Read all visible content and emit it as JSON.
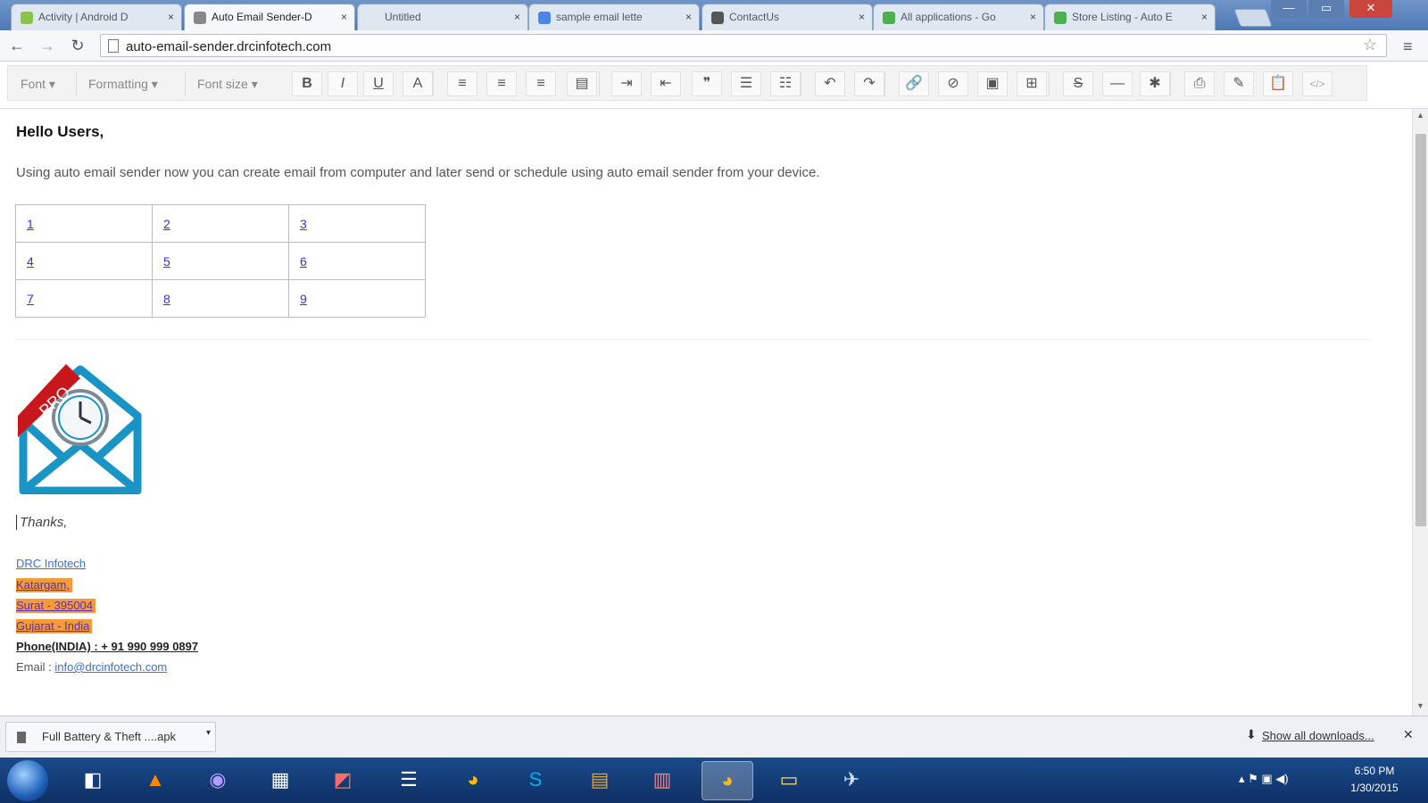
{
  "browser": {
    "tabs": [
      {
        "title": "Activity | Android D",
        "favicon_color": "#8bc34a"
      },
      {
        "title": "Auto Email Sender-D",
        "favicon_color": "#888888",
        "active": true
      },
      {
        "title": "Untitled",
        "favicon_color": ""
      },
      {
        "title": "sample email lette",
        "favicon_color": "#4a86e8"
      },
      {
        "title": "ContactUs",
        "favicon_color": "#555555"
      },
      {
        "title": "All applications - Go",
        "favicon_color": "#4caf50"
      },
      {
        "title": "Store Listing - Auto E",
        "favicon_color": "#4caf50"
      }
    ],
    "close_glyph": "×",
    "address": "auto-email-sender.drcinfotech.com",
    "window_controls": {
      "minimize": "—",
      "maximize": "▭",
      "close": "✕"
    }
  },
  "toolbar": {
    "font_label": "Font",
    "formatting_label": "Formatting",
    "font_size_label": "Font size",
    "buttons": [
      {
        "name": "bold-button",
        "glyph": "B"
      },
      {
        "name": "italic-button",
        "glyph": "I"
      },
      {
        "name": "underline-button",
        "glyph": "U"
      },
      {
        "name": "font-color-button",
        "glyph": "A"
      },
      {
        "name": "align-left-button",
        "glyph": "≡"
      },
      {
        "name": "align-center-button",
        "glyph": "≡"
      },
      {
        "name": "align-right-button",
        "glyph": "≡"
      },
      {
        "name": "justify-button",
        "glyph": "▤"
      },
      {
        "name": "indent-button",
        "glyph": "⇥"
      },
      {
        "name": "outdent-button",
        "glyph": "⇤"
      },
      {
        "name": "blockquote-button",
        "glyph": "❞"
      },
      {
        "name": "ordered-list-button",
        "glyph": "☰"
      },
      {
        "name": "unordered-list-button",
        "glyph": "☷"
      },
      {
        "name": "undo-button",
        "glyph": "↶"
      },
      {
        "name": "redo-button",
        "glyph": "↷"
      },
      {
        "name": "link-button",
        "glyph": "🔗"
      },
      {
        "name": "unlink-button",
        "glyph": "⊘"
      },
      {
        "name": "image-button",
        "glyph": "▣"
      },
      {
        "name": "table-button",
        "glyph": "⊞"
      },
      {
        "name": "strikethrough-button",
        "glyph": "S"
      },
      {
        "name": "horizontal-rule-button",
        "glyph": "—"
      },
      {
        "name": "special-char-button",
        "glyph": "✱"
      },
      {
        "name": "print-button",
        "glyph": "⎙"
      },
      {
        "name": "clear-format-button",
        "glyph": "✎"
      },
      {
        "name": "paste-button",
        "glyph": "📋"
      },
      {
        "name": "source-button",
        "glyph": "</>"
      }
    ]
  },
  "email": {
    "greeting": "Hello  Users,",
    "intro": "Using auto email sender now you can create email from computer and later send or schedule using auto email sender from your device.",
    "table": [
      [
        "1",
        "2",
        "3"
      ],
      [
        "4",
        "5",
        "6"
      ],
      [
        "7",
        "8",
        "9"
      ]
    ],
    "logo_badge": "PRO",
    "thanks": "Thanks,",
    "company": "DRC Infotech",
    "address_lines": [
      "Katargam,",
      "Surat - 395004",
      "Gujarat - India"
    ],
    "phone": "Phone(INDIA) : + 91 990 999 0897",
    "email_label": "Email : ",
    "email_value": "info@drcinfotech.com"
  },
  "downloads": {
    "item": "Full Battery & Theft ....apk",
    "show_all": "Show all downloads..."
  },
  "taskbar": {
    "time": "6:50 PM",
    "date": "1/30/2015"
  }
}
